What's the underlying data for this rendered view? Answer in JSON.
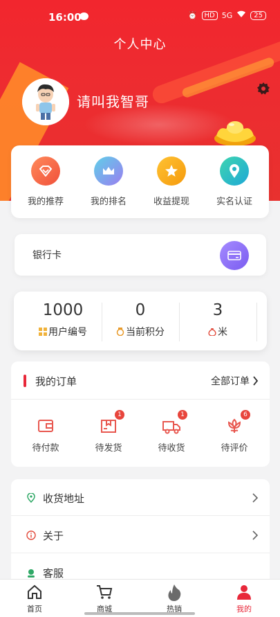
{
  "status_bar": {
    "time": "16:00",
    "hd": "HD",
    "network": "5G",
    "battery": "25"
  },
  "header": {
    "title": "个人中心"
  },
  "profile": {
    "username": "请叫我智哥"
  },
  "quick_menu": [
    {
      "label": "我的推荐",
      "icon": "diamond-icon",
      "color": "#f0563c"
    },
    {
      "label": "我的排名",
      "icon": "crown-icon",
      "color": "#2fb6d8"
    },
    {
      "label": "收益提现",
      "icon": "star-icon",
      "color": "#f5a312"
    },
    {
      "label": "实名认证",
      "icon": "location-pin-icon",
      "color": "#22c1a8"
    }
  ],
  "bank_card": {
    "label": "银行卡",
    "icon": "card-icon"
  },
  "stats": [
    {
      "value": "1000",
      "label": "用户编号",
      "icon": "grid-icon"
    },
    {
      "value": "0",
      "label": "当前积分",
      "icon": "medal-icon"
    },
    {
      "value": "3",
      "label": "米",
      "icon": "money-bag-icon"
    }
  ],
  "orders": {
    "title": "我的订单",
    "all_label": "全部订单",
    "items": [
      {
        "label": "待付款",
        "icon": "wallet-icon",
        "badge": ""
      },
      {
        "label": "待发货",
        "icon": "package-icon",
        "badge": "1"
      },
      {
        "label": "待收货",
        "icon": "truck-icon",
        "badge": "1"
      },
      {
        "label": "待评价",
        "icon": "flower-icon",
        "badge": "6"
      }
    ]
  },
  "settings": [
    {
      "label": "收货地址",
      "icon": "location-icon"
    },
    {
      "label": "关于",
      "icon": "info-icon"
    },
    {
      "label": "客服",
      "icon": "headset-icon"
    }
  ],
  "tabbar": [
    {
      "label": "首页",
      "icon": "home-icon",
      "active": false
    },
    {
      "label": "商城",
      "icon": "cart-icon",
      "active": false
    },
    {
      "label": "热销",
      "icon": "flame-icon",
      "active": false
    },
    {
      "label": "我的",
      "icon": "user-icon",
      "active": true
    }
  ],
  "colors": {
    "primary": "#ee2b30",
    "accent_red": "#e8283a"
  }
}
